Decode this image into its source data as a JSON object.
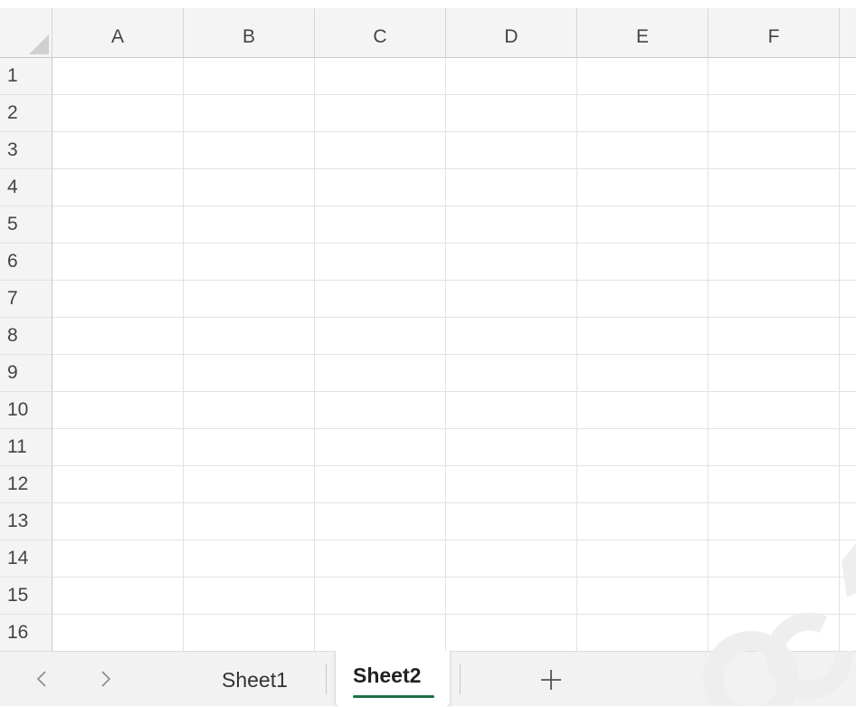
{
  "columns": [
    "A",
    "B",
    "C",
    "D",
    "E",
    "F"
  ],
  "rows": [
    "1",
    "2",
    "3",
    "4",
    "5",
    "6",
    "7",
    "8",
    "9",
    "10",
    "11",
    "12",
    "13",
    "14",
    "15",
    "16"
  ],
  "sheet_tabs": [
    {
      "label": "Sheet1",
      "active": false
    },
    {
      "label": "Sheet2",
      "active": true
    }
  ],
  "nav": {
    "prev_icon": "chevron-left-icon",
    "next_icon": "chevron-right-icon",
    "add_icon": "plus-icon"
  },
  "colors": {
    "header_bg": "#f4f4f4",
    "gridline": "#e2e2e2",
    "active_tab_underline": "#1e7145",
    "tabbar_bg": "#f2f2f2"
  }
}
